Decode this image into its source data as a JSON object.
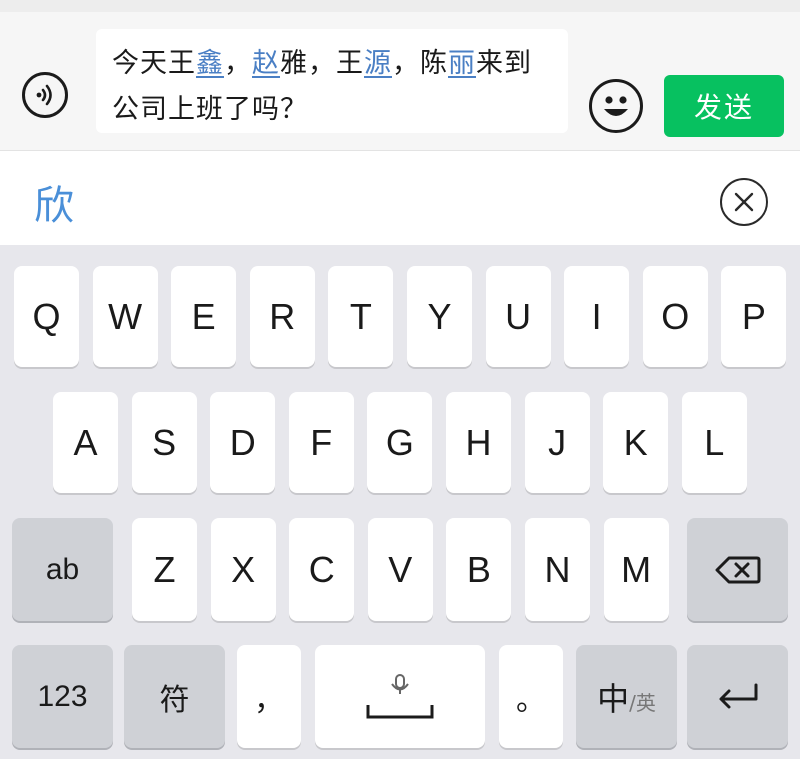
{
  "composer": {
    "message_segments": [
      {
        "text": "今天王",
        "hl": false
      },
      {
        "text": "鑫",
        "hl": true
      },
      {
        "text": "，",
        "hl": false
      },
      {
        "text": "赵",
        "hl": true
      },
      {
        "text": "雅，王",
        "hl": false
      },
      {
        "text": "源",
        "hl": true
      },
      {
        "text": "，陈",
        "hl": false
      },
      {
        "text": "丽",
        "hl": true
      },
      {
        "text": "来到公司上班了吗？",
        "hl": false
      }
    ],
    "send_label": "发送",
    "voice_icon": "voice-icon",
    "emoji_icon": "emoji-icon"
  },
  "candidates": {
    "items": [
      "欣"
    ],
    "close_icon": "close-circle-icon"
  },
  "keyboard": {
    "row1": [
      "Q",
      "W",
      "E",
      "R",
      "T",
      "Y",
      "U",
      "I",
      "O",
      "P"
    ],
    "row2": [
      "A",
      "S",
      "D",
      "F",
      "G",
      "H",
      "J",
      "K",
      "L"
    ],
    "row3": [
      "Z",
      "X",
      "C",
      "V",
      "B",
      "N",
      "M"
    ],
    "shift_label": "ab",
    "num_label": "123",
    "symbol_label": "符",
    "comma_label": "，",
    "period_label": "。",
    "lang_main": "中",
    "lang_sep": "/",
    "lang_sub": "英",
    "backspace_icon": "backspace-icon",
    "mic_icon": "mic-icon",
    "enter_icon": "enter-icon"
  },
  "colors": {
    "send_button": "#07c160",
    "highlight_text": "#4a7fc4",
    "candidate_text": "#4a8fd8"
  }
}
